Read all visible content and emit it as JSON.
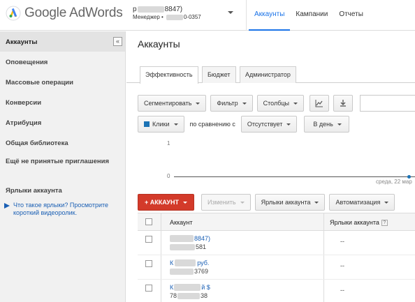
{
  "header": {
    "logo_text": "Google AdWords",
    "account": {
      "name_prefix": "р",
      "name_suffix": "8847)",
      "role_prefix": "Менеджер •",
      "role_suffix": "0-0357"
    },
    "nav": [
      {
        "label": "Аккаунты",
        "active": true
      },
      {
        "label": "Кампании",
        "active": false
      },
      {
        "label": "Отчеты",
        "active": false
      }
    ]
  },
  "sidebar": {
    "collapse_label": "«",
    "items": [
      {
        "label": "Аккаунты",
        "active": true
      },
      {
        "label": "Оповещения"
      },
      {
        "label": "Массовые операции"
      },
      {
        "label": "Конверсии"
      },
      {
        "label": "Атрибуция"
      },
      {
        "label": "Общая библиотека"
      },
      {
        "label": "Ещё не принятые приглашения"
      },
      {
        "label": "Ярлыки аккаунта"
      }
    ],
    "help_text": "Что такое ярлыки? Просмотрите короткий видеоролик."
  },
  "main": {
    "title": "Аккаунты",
    "tabs": [
      {
        "label": "Эффективность",
        "active": true
      },
      {
        "label": "Бюджет"
      },
      {
        "label": "Администратор"
      }
    ],
    "toolbar": {
      "segment": "Сегментировать",
      "filter": "Фильтр",
      "columns": "Столбцы"
    },
    "metrics": {
      "metric_label": "Клики",
      "compare_text": "по сравнению с",
      "compare_value": "Отсутствует",
      "period": "В день"
    },
    "chart_axis": {
      "y_top": "1",
      "y_bottom": "0",
      "x_label": "среда, 22 мар"
    },
    "actions": {
      "add_account": "+ АККАУНТ",
      "edit": "Изменить",
      "labels": "Ярлыки аккаунта",
      "automation": "Автоматизация"
    },
    "table": {
      "headers": {
        "account": "Аккаунт",
        "labels": "Ярлыки аккаунта",
        "help": "?"
      },
      "rows": [
        {
          "name_prefix": "",
          "name_suffix": "8847)",
          "id_prefix": "",
          "id_suffix": "581",
          "labels": "--"
        },
        {
          "name_prefix": "К",
          "name_suffix": "руб.",
          "id_prefix": "",
          "id_suffix": "3769",
          "labels": "--"
        },
        {
          "name_prefix": "К",
          "name_suffix": "й $",
          "id_prefix": "78",
          "id_suffix": "38",
          "labels": "--"
        }
      ]
    }
  },
  "colors": {
    "accent": "#1a73e8",
    "link": "#1a5fb4",
    "add_button": "#d33a2a",
    "metric_swatch": "#1c73b5"
  }
}
